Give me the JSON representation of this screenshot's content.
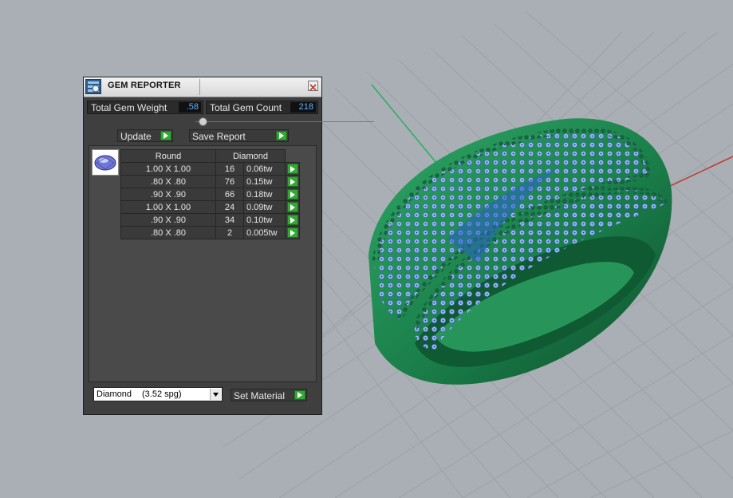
{
  "panel": {
    "title": "GEM REPORTER",
    "total_weight_label": "Total Gem Weight",
    "total_weight_value": ".58",
    "total_count_label": "Total Gem Count",
    "total_count_value": "218",
    "update_label": "Update",
    "save_report_label": "Save Report",
    "table": {
      "shape_header": "Round",
      "material_header": "Diamond",
      "rows": [
        {
          "size": "1.00 X 1.00",
          "count": "16",
          "weight": "0.06tw"
        },
        {
          "size": ".80 X .80",
          "count": "76",
          "weight": "0.15tw"
        },
        {
          "size": ".90 X .90",
          "count": "66",
          "weight": "0.18tw"
        },
        {
          "size": "1.00 X 1.00",
          "count": "24",
          "weight": "0.09tw"
        },
        {
          "size": ".90 X .90",
          "count": "34",
          "weight": "0.10tw"
        },
        {
          "size": ".80 X .80",
          "count": "2",
          "weight": "0.005tw"
        }
      ]
    },
    "material_select": {
      "value": "Diamond",
      "spg": "(3.52 spg)"
    },
    "set_material_label": "Set Material"
  },
  "icons": {
    "app": "gem-reporter-icon",
    "close": "close-icon",
    "go": "green-arrow-icon",
    "gem": "round-gem-icon",
    "dropdown": "chevron-down-icon"
  },
  "colors": {
    "viewport_bg": "#a9afb4",
    "panel_bg": "#3f3f3f",
    "value_text": "#5fb4ff",
    "go_button": "#34a834",
    "ring_metal": "#1f8a52",
    "gem_blue": "#8fb7f0",
    "axis_x": "#c0392b",
    "axis_y": "#27ae60"
  }
}
